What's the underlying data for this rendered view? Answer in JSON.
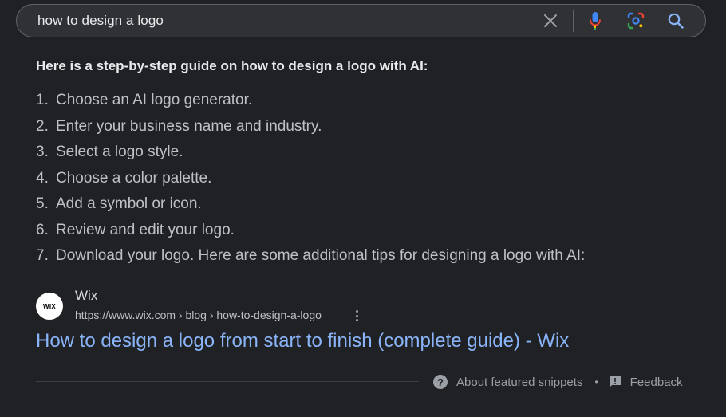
{
  "search": {
    "query": "how to design a logo",
    "icons": [
      "close-icon",
      "microphone-icon",
      "lens-icon",
      "search-icon"
    ]
  },
  "snippet": {
    "heading": "Here is a step-by-step guide on how to design a logo with AI:",
    "steps": [
      {
        "num": "1.",
        "text": "Choose an AI logo generator."
      },
      {
        "num": "2.",
        "text": "Enter your business name and industry."
      },
      {
        "num": "3.",
        "text": "Select a logo style."
      },
      {
        "num": "4.",
        "text": "Choose a color palette."
      },
      {
        "num": "5.",
        "text": "Add a symbol or icon."
      },
      {
        "num": "6.",
        "text": "Review and edit your logo."
      },
      {
        "num": "7.",
        "text": "Download your logo. Here are some additional tips for designing a logo with AI:"
      }
    ]
  },
  "source": {
    "favicon_text": "WIX",
    "site_name": "Wix",
    "url": "https://www.wix.com › blog › how-to-design-a-logo"
  },
  "result": {
    "title": "How to design a logo from start to finish (complete guide) - Wix"
  },
  "footer": {
    "about_label": "About featured snippets",
    "separator": "•",
    "feedback_label": "Feedback"
  },
  "colors": {
    "background": "#202124",
    "link": "#8ab4f8",
    "text": "#bdc1c6",
    "heading": "#e8eaed"
  }
}
